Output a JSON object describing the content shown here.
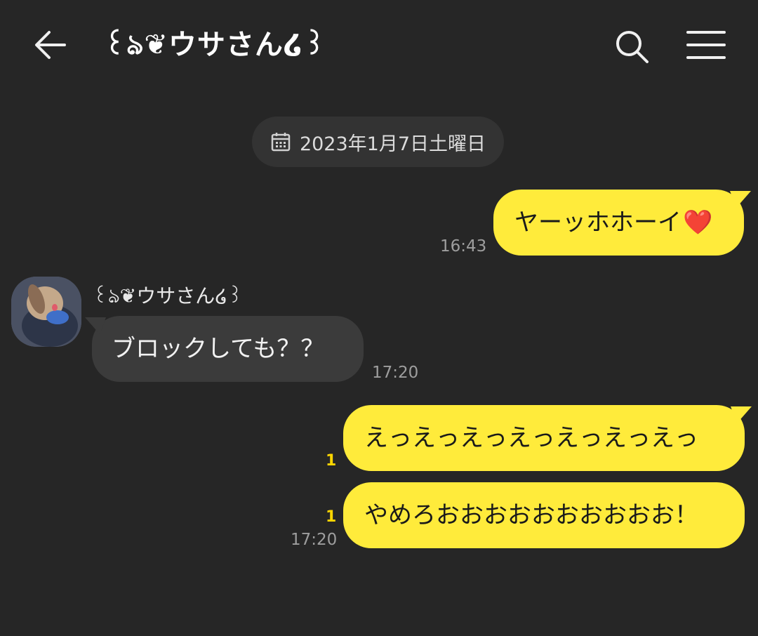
{
  "header": {
    "title": "꒰ঌ❦ウサさん໒꒱",
    "back_icon": "arrow-left-icon",
    "search_icon": "search-icon",
    "menu_icon": "hamburger-menu-icon"
  },
  "date_separator": {
    "icon": "calendar-icon",
    "label": "2023年1月7日土曜日"
  },
  "messages": [
    {
      "side": "sent",
      "text": "ヤーッホホーイ",
      "emoji": "❤️",
      "time": "16:43"
    },
    {
      "side": "received",
      "sender": "꒰ঌ❦ウサさん໒꒱",
      "text": "ブロックしても？？",
      "time": "17:20"
    },
    {
      "side": "sent",
      "text": "えっえっえっえっえっえっえっ",
      "unread": "1"
    },
    {
      "side": "sent",
      "text": "やめろおおおおおおおおおお！",
      "unread": "1",
      "time": "17:20"
    }
  ],
  "colors": {
    "background": "#262626",
    "sent_bubble": "#ffeb3b",
    "received_bubble": "#3b3b3b",
    "unread_count": "#ffd600"
  }
}
